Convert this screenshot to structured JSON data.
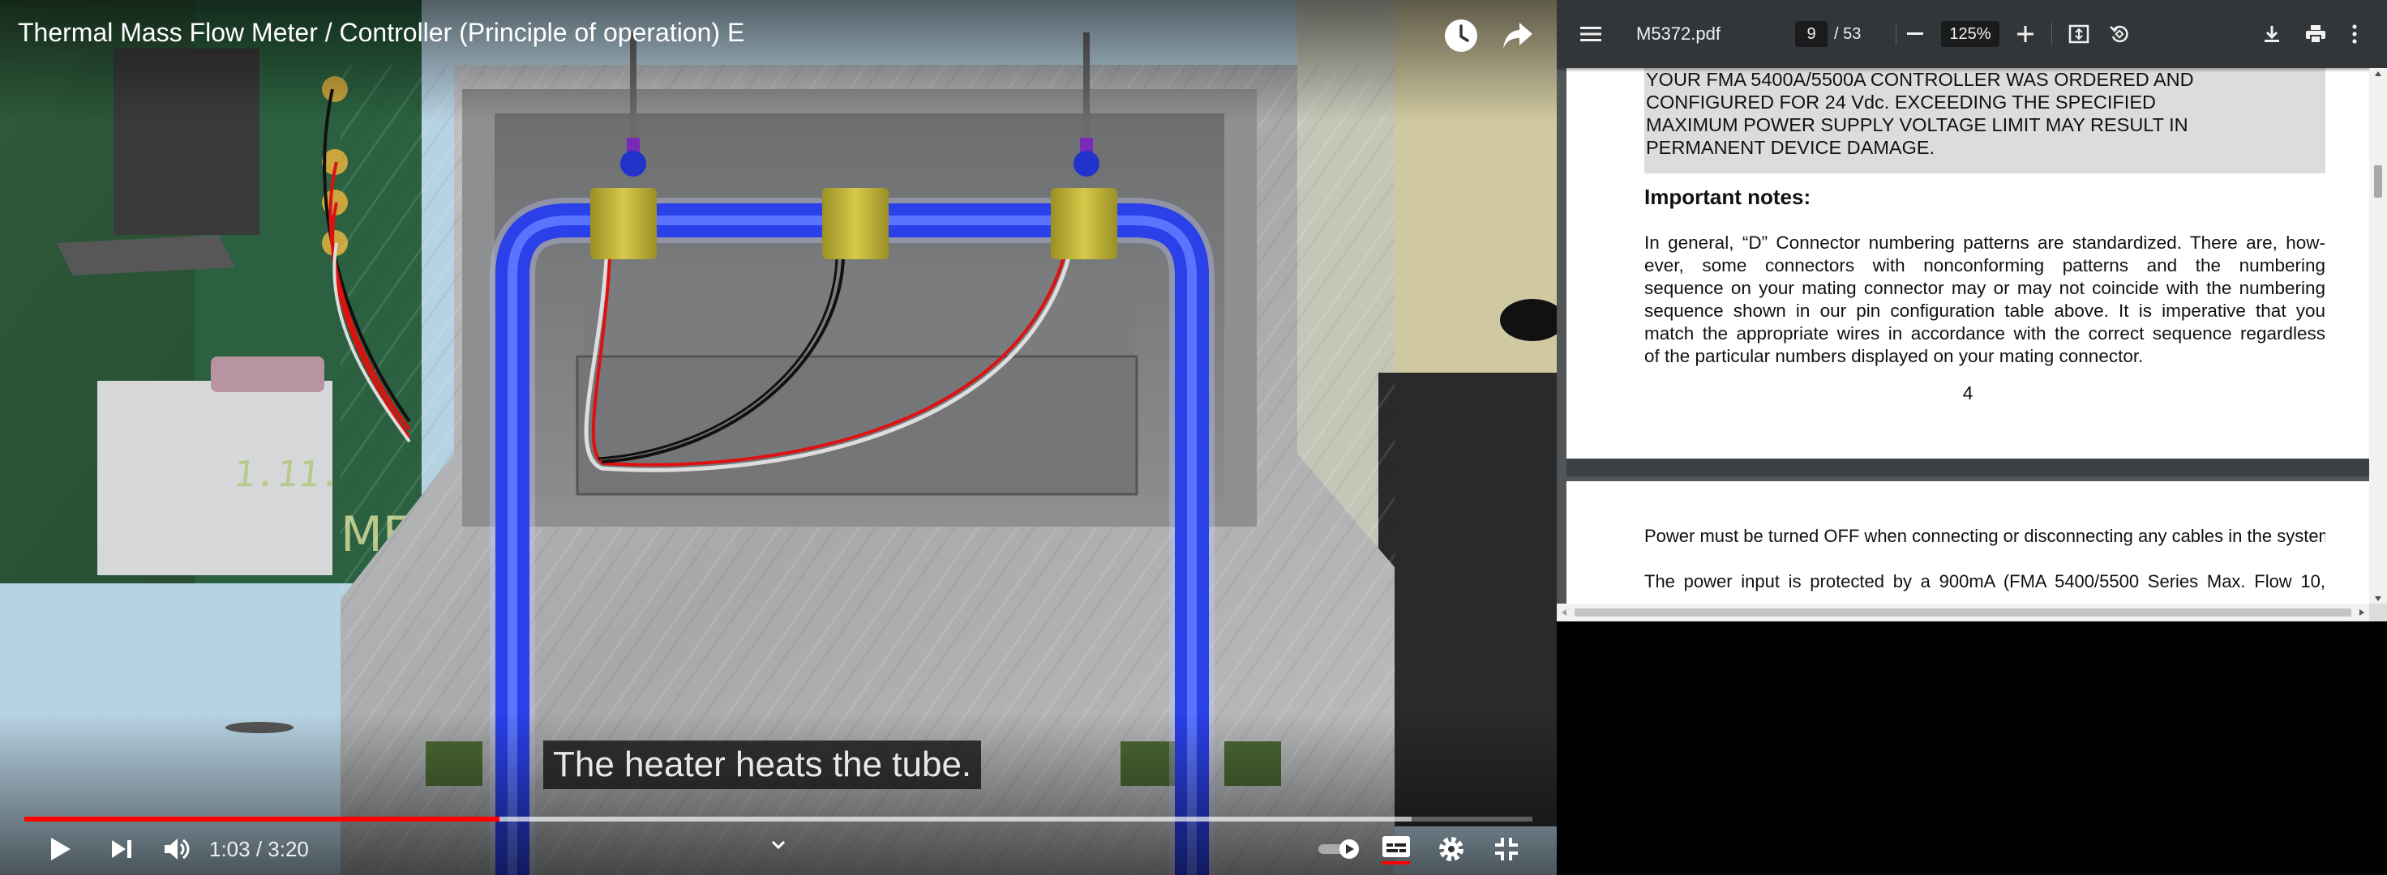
{
  "video": {
    "title": "Thermal Mass Flow Meter / Controller (Principle of operation) E",
    "caption": "The heater heats the tube.",
    "time_display": "1:03 / 3:20",
    "progress_played_fraction": 0.315,
    "progress_buffered_fraction": 0.92,
    "icons": {
      "watch_later": "clock-icon",
      "share": "share-arrow-icon",
      "play": "play-icon",
      "next": "skip-next-icon",
      "volume": "volume-icon",
      "chapter": "chevron-down-icon",
      "autoplay": "autoplay-toggle-icon",
      "subtitles": "subtitles-icon",
      "settings": "gear-icon",
      "fullscreen": "exit-fullscreen-icon"
    },
    "accent_color": "#ff0000"
  },
  "pdf": {
    "file_name": "M5372.pdf",
    "current_page": "9",
    "page_total": "/ 53",
    "zoom": "125%",
    "icons": {
      "menu": "hamburger-menu-icon",
      "zoom_out": "minus-icon",
      "zoom_in": "plus-icon",
      "fit": "fit-page-icon",
      "rotate": "rotate-icon",
      "download": "download-icon",
      "print": "print-icon",
      "more": "more-vert-icon"
    },
    "page_a": {
      "warning_lines": [
        "YOUR FMA 5400A/5500A CONTROLLER WAS ORDERED AND",
        "CONFIGURED FOR 24 Vdc. EXCEEDING THE SPECIFIED",
        "MAXIMUM POWER SUPPLY VOLTAGE LIMIT MAY RESULT IN",
        "PERMANENT DEVICE DAMAGE."
      ],
      "notes_title": "Important notes:",
      "body_lines": [
        "In general, “D” Connector numbering patterns are standardized. There are, how-",
        "ever, some connectors with nonconforming patterns and the numbering",
        "sequence on your mating connector may or may not coincide with the numbering",
        "sequence shown in our pin configuration table above. It is imperative that you",
        "match the appropriate wires in accordance with the correct sequence regardless",
        "of the particular numbers displayed on your mating connector."
      ],
      "page_number": "4"
    },
    "page_b": {
      "line1": "Power must be turned OFF when connecting or disconnecting any cables in the system.",
      "line2": "The power input is protected by a 900mA (FMA 5400/5500 Series Max. Flow 10,"
    }
  }
}
